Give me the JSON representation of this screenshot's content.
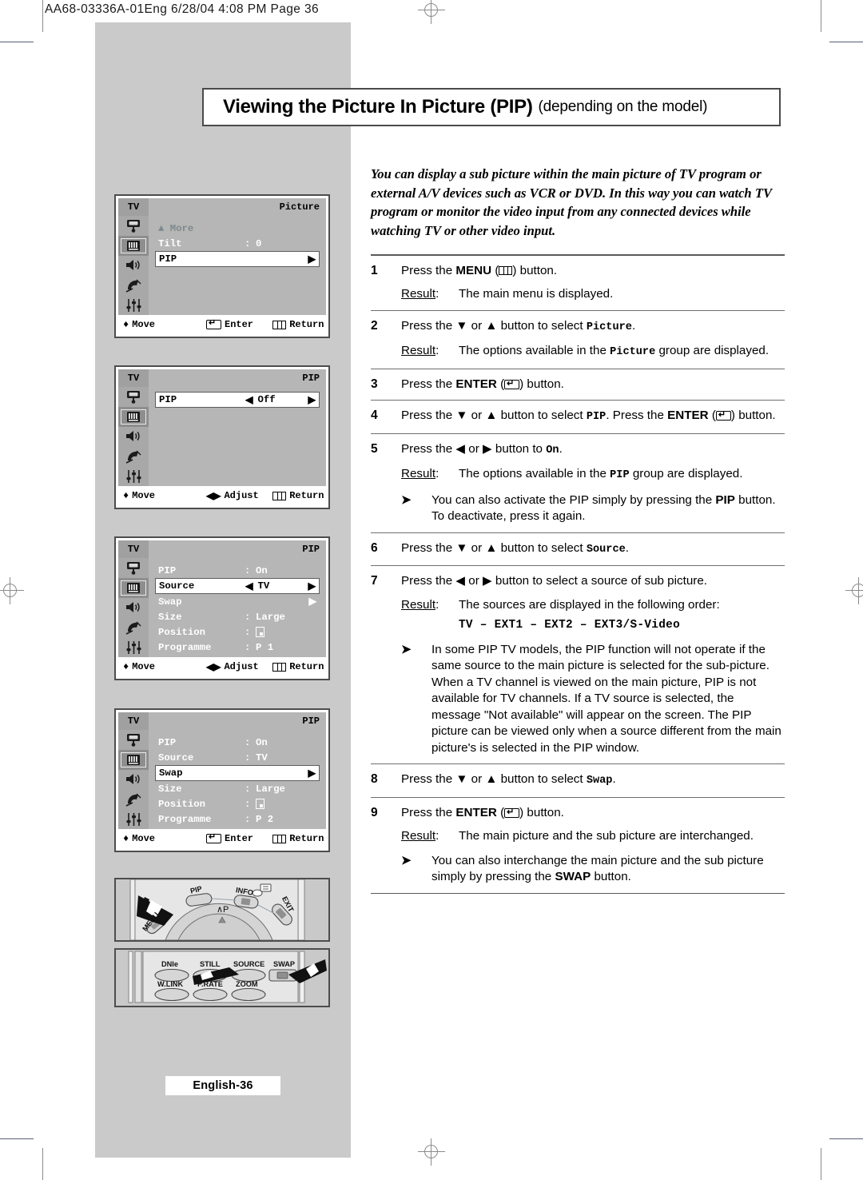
{
  "sheet": {
    "header": "AA68-03336A-01Eng     6/28/04   4:08 PM   Page 36",
    "page_badge": "English-36"
  },
  "banner": {
    "title_bold": "Viewing the Picture In Picture (PIP)",
    "title_light": "(depending on the model)"
  },
  "intro": {
    "text": "You can display a sub picture within the main picture of TV program or external A/V devices such as VCR or DVD. In this way you can watch TV program or monitor the video input from any connected devices while watching TV or other video input."
  },
  "steps": [
    {
      "num": "1",
      "pre": "Press the ",
      "bold": "MENU",
      "icon": "menu-icon",
      "post": " button.",
      "result_label": "Result",
      "result_text": "The main menu is displayed."
    },
    {
      "num": "2",
      "pre": "Press the ▼ or ▲ button to select ",
      "mono": "Picture",
      "post": ".",
      "result_label": "Result",
      "result_pre": "The options available in the ",
      "result_mono": "Picture",
      "result_post": " group are displayed."
    },
    {
      "num": "3",
      "pre": "Press the ",
      "bold": "ENTER",
      "icon": "enter-icon",
      "post": " button."
    },
    {
      "num": "4",
      "pre": "Press the ▼ or ▲  button to select ",
      "mono": "PIP",
      "mid": ". Press the ",
      "bold": "ENTER",
      "icon": "enter-icon",
      "post": " button."
    },
    {
      "num": "5",
      "pre": "Press the ◀ or ▶ button to ",
      "mono": "On",
      "post": ".",
      "result_label": "Result",
      "result_pre": "The options available in the ",
      "result_mono": "PIP",
      "result_post": " group are displayed.",
      "note_pre": "You can also activate the PIP simply by pressing the ",
      "note_bold": "PIP",
      "note_post": " button. To deactivate, press it again."
    },
    {
      "num": "6",
      "pre": "Press the ▼ or ▲ button to select ",
      "mono": "Source",
      "post": "."
    },
    {
      "num": "7",
      "pre": "Press the ◀ or ▶ button to select a source of sub picture.",
      "result_label": "Result",
      "result_text": "The sources are displayed in the following order:",
      "source_order": "TV – EXT1 – EXT2 – EXT3/S-Video",
      "note_long": "In some PIP TV models, the PIP function will not operate if the same source to the main picture is selected for the sub-picture. When a TV channel is viewed on the main picture, PIP is not available for TV channels. If a TV source is selected, the message \"Not available\" will appear on the screen. The PIP picture can be viewed only when a source different from the main picture's is selected in the PIP window."
    },
    {
      "num": "8",
      "pre": "Press the ▼ or ▲ button to select ",
      "mono": "Swap",
      "post": "."
    },
    {
      "num": "9",
      "pre": "Press the ",
      "bold": "ENTER",
      "icon": "enter-icon",
      "post": " button.",
      "result_label": "Result",
      "result_text": "The main picture and the sub picture are interchanged.",
      "note_pre": "You can also interchange the main picture and the sub picture simply by pressing the ",
      "note_bold": "SWAP",
      "note_post": " button."
    }
  ],
  "osd_screens": [
    {
      "tv_label": "TV",
      "title": "Picture",
      "footer": {
        "move": "Move",
        "action": "Enter",
        "return": "Return",
        "action_icon": "enter-icon"
      },
      "rows": [
        {
          "key": "▲ More",
          "value": "",
          "style": "dim"
        },
        {
          "key": "Tilt",
          "colon": ":",
          "value": "0",
          "style": "normal"
        },
        {
          "key": "PIP",
          "value": "",
          "right_arrow": "▶",
          "style": "highlight"
        }
      ]
    },
    {
      "tv_label": "TV",
      "title": "PIP",
      "footer": {
        "move": "Move",
        "action": "Adjust",
        "return": "Return",
        "action_icon": "left-right-icon"
      },
      "rows": [
        {
          "key": "PIP",
          "left_arrow": "◀",
          "value": "Off",
          "right_arrow": "▶",
          "style": "highlight"
        }
      ]
    },
    {
      "tv_label": "TV",
      "title": "PIP",
      "footer": {
        "move": "Move",
        "action": "Adjust",
        "return": "Return",
        "action_icon": "left-right-icon"
      },
      "rows": [
        {
          "key": "PIP",
          "colon": ":",
          "value": "On",
          "style": "normal"
        },
        {
          "key": "Source",
          "left_arrow": "◀",
          "value": "TV",
          "right_arrow": "▶",
          "style": "highlight"
        },
        {
          "key": "Swap",
          "value": "",
          "right_arrow": "▶",
          "style": "normal"
        },
        {
          "key": "Size",
          "colon": ":",
          "value": "Large",
          "style": "normal"
        },
        {
          "key": "Position",
          "colon": ":",
          "value": "",
          "glyph": "position-icon",
          "style": "normal"
        },
        {
          "key": "Programme",
          "colon": ":",
          "value": "P 1",
          "style": "normal"
        }
      ]
    },
    {
      "tv_label": "TV",
      "title": "PIP",
      "footer": {
        "move": "Move",
        "action": "Enter",
        "return": "Return",
        "action_icon": "enter-icon"
      },
      "rows": [
        {
          "key": "PIP",
          "colon": ":",
          "value": "On",
          "style": "normal"
        },
        {
          "key": "Source",
          "colon": ":",
          "value": "TV",
          "style": "normal"
        },
        {
          "key": "Swap",
          "value": "",
          "right_arrow": "▶",
          "style": "highlight"
        },
        {
          "key": "Size",
          "colon": ":",
          "value": "Large",
          "style": "normal"
        },
        {
          "key": "Position",
          "colon": ":",
          "value": "",
          "glyph": "position-icon",
          "style": "normal"
        },
        {
          "key": "Programme",
          "colon": ":",
          "value": "P 2",
          "style": "normal"
        }
      ]
    }
  ],
  "osd_rail_icons": [
    "tv-monitor-icon",
    "picture-bars-icon",
    "speaker-icon",
    "satellite-dish-icon",
    "sliders-icon"
  ],
  "remote_top": {
    "buttons": [
      {
        "label": "MENU"
      },
      {
        "label": "PIP"
      },
      {
        "label": "INFO"
      },
      {
        "label": "EXIT"
      }
    ],
    "channel_label": "∧P"
  },
  "remote_bottom": {
    "row1": [
      "DNIe",
      "STILL",
      "SOURCE",
      "SWAP"
    ],
    "row2": [
      "W.LINK",
      "P.RATE",
      "ZOOM"
    ]
  },
  "colors": {
    "panel_gray": "#cacaca",
    "osd_bg": "#b6b6b6",
    "osd_rail": "#a8a8a8",
    "osd_highlight": "#ffffff",
    "rule": "#6f6f6f"
  }
}
